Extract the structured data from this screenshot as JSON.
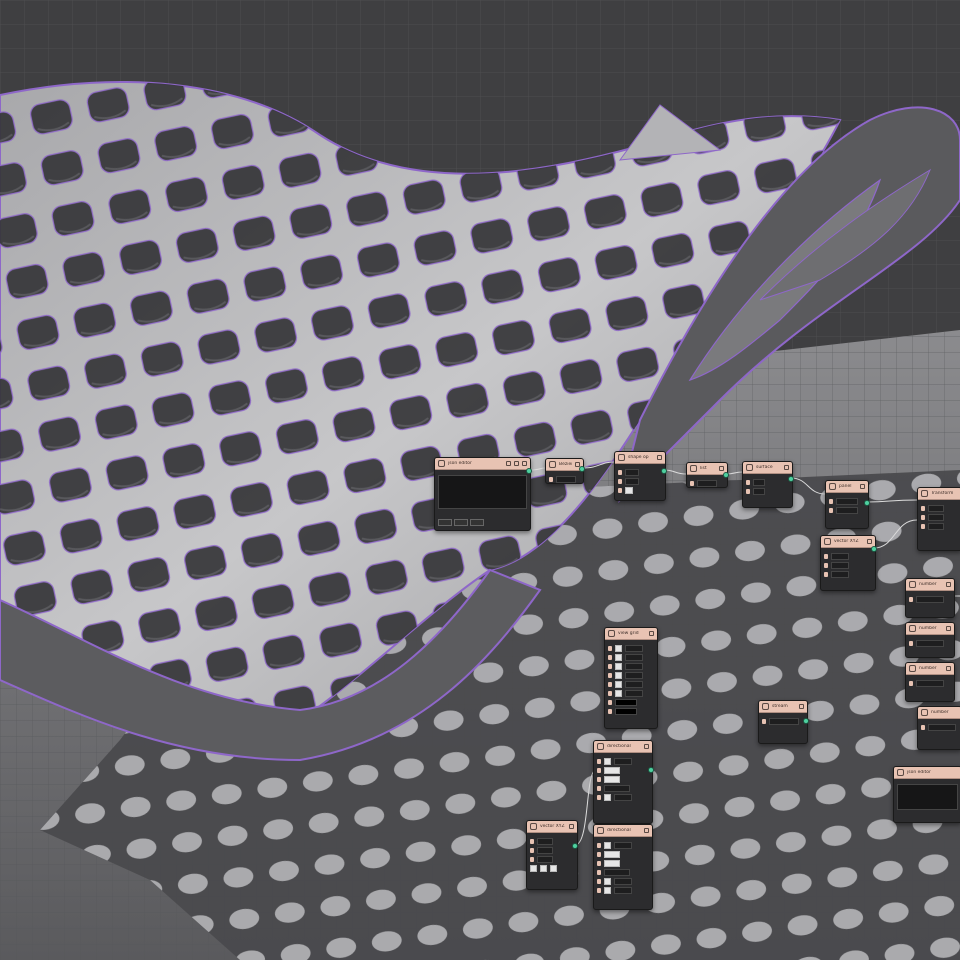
{
  "colors": {
    "background": "#3f3f41",
    "node_header": "#e8c3b3",
    "node_body": "#2c2c2e",
    "accent_port": "#4fd1a0",
    "surface_edge": "#8e67c9"
  },
  "nodes": {
    "n1": {
      "title": "json editor",
      "icon": "braces-icon"
    },
    "n2": {
      "title": "Bezier",
      "icon": "curve-icon"
    },
    "n3": {
      "title": "shape op",
      "icon": "shape-icon"
    },
    "n4": {
      "title": "list",
      "icon": "list-icon"
    },
    "n5": {
      "title": "surface",
      "icon": "surface-icon"
    },
    "n6": {
      "title": "panel",
      "icon": "panel-icon"
    },
    "n7": {
      "title": "vector XYZ",
      "icon": "vector-icon"
    },
    "n8": {
      "title": "Transform",
      "icon": "transform-icon"
    },
    "n9": {
      "title": "number",
      "icon": "number-icon"
    },
    "n10": {
      "title": "number",
      "icon": "number-icon"
    },
    "n11": {
      "title": "number",
      "icon": "number-icon"
    },
    "n12": {
      "title": "number",
      "icon": "number-icon"
    },
    "n13": {
      "title": "view grid",
      "icon": "grid-icon"
    },
    "n14": {
      "title": "stream",
      "icon": "gear-icon"
    },
    "n15": {
      "title": "json editor",
      "icon": "braces-icon"
    },
    "n16": {
      "title": "directional",
      "icon": "light-icon"
    },
    "n17": {
      "title": "vector XYZ",
      "icon": "vector-icon"
    },
    "n18": {
      "title": "directional",
      "icon": "light-icon"
    }
  }
}
